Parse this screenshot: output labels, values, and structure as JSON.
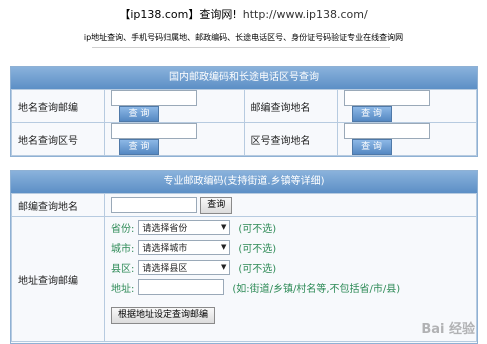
{
  "header": {
    "title": "【ip138.com】查询网!",
    "url": "http://www.ip138.com/",
    "description": "ip地址查询、手机号码归属地、邮政编码、长途电话区号、身份证号码验证专业在线查询网"
  },
  "panel1": {
    "heading": "国内邮政编码和长途电话区号查询",
    "rows": [
      {
        "left_label": "地名查询邮编",
        "left_button": "查 询",
        "right_label": "邮编查询地名",
        "right_button": "查 询"
      },
      {
        "left_label": "地名查询区号",
        "left_button": "查 询",
        "right_label": "区号查询地名",
        "right_button": "查 询"
      }
    ]
  },
  "panel2": {
    "heading": "专业邮政编码(支持街道.乡镇等详细)",
    "zip_label": "邮编查询地名",
    "zip_button": "查询",
    "address_label": "地址查询邮编",
    "province_label": "省份:",
    "province_value": "请选择省份",
    "city_label": "城市:",
    "city_value": "请选择城市",
    "county_label": "县区:",
    "county_value": "请选择县区",
    "optional_note": "(可不选)",
    "address_field_label": "地址:",
    "address_hint": "(如:街道/乡镇/村名等,不包括省/市/县)",
    "submit_button": "根据地址设定查询邮编"
  },
  "watermark": "Bai 经验"
}
